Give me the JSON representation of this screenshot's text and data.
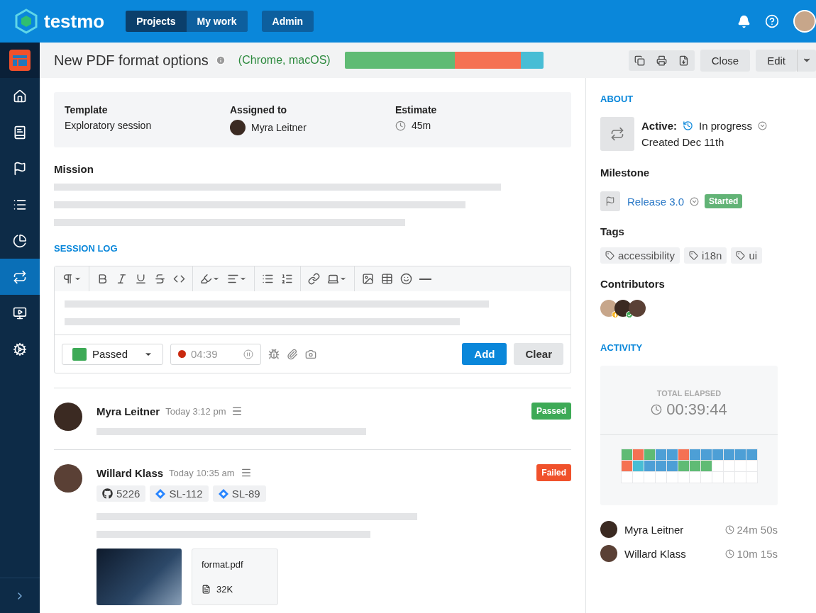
{
  "header": {
    "logo": "testmo",
    "nav": [
      {
        "label": "Projects",
        "selected": true
      },
      {
        "label": "My work",
        "selected": false
      }
    ],
    "admin": "Admin"
  },
  "sidebar": {
    "items": [
      {
        "kind": "home",
        "selected": false
      },
      {
        "kind": "book",
        "selected": false
      },
      {
        "kind": "flag",
        "selected": false
      },
      {
        "kind": "list",
        "selected": false
      },
      {
        "kind": "pie",
        "selected": false
      },
      {
        "kind": "repeat",
        "selected": true
      },
      {
        "kind": "monitor",
        "selected": false
      },
      {
        "kind": "gears",
        "selected": false
      }
    ]
  },
  "titlebar": {
    "title": "New PDF format options",
    "config": "(Chrome, macOS)",
    "close": "Close",
    "edit": "Edit"
  },
  "info": [
    {
      "label": "Template",
      "value": "Exploratory session",
      "kind": "text"
    },
    {
      "label": "Assigned to",
      "value": "Myra Leitner",
      "kind": "user"
    },
    {
      "label": "Estimate",
      "value": "45m",
      "kind": "time"
    }
  ],
  "mission": {
    "label": "Mission"
  },
  "session_log": {
    "label": "SESSION LOG",
    "status": {
      "label": "Passed",
      "color": "#3daa56"
    },
    "timer": "04:39",
    "add": "Add",
    "clear": "Clear"
  },
  "entries": [
    {
      "author": "Myra Leitner",
      "time": "Today 3:12 pm",
      "status": "Passed",
      "color": "#3daa56"
    },
    {
      "author": "Willard Klass",
      "time": "Today 10:35 am",
      "status": "Failed",
      "color": "#f0512b",
      "links": [
        {
          "kind": "github",
          "label": "5226"
        },
        {
          "kind": "jira",
          "label": "SL-112"
        },
        {
          "kind": "jira",
          "label": "SL-89"
        }
      ],
      "attachments": [
        {
          "kind": "image"
        },
        {
          "kind": "file",
          "name": "format.pdf",
          "size": "32K"
        }
      ]
    }
  ],
  "about": {
    "heading": "ABOUT",
    "active_label": "Active:",
    "state": "In progress",
    "created": "Created Dec 11th",
    "milestone_heading": "Milestone",
    "milestone": "Release 3.0",
    "milestone_status": "Started",
    "tags_heading": "Tags",
    "tags": [
      "accessibility",
      "i18n",
      "ui"
    ],
    "contributors_heading": "Contributors",
    "contributors": [
      {
        "kind": "added"
      },
      {
        "kind": "passed"
      },
      {
        "kind": "plain"
      }
    ]
  },
  "activity": {
    "heading": "ACTIVITY",
    "elapsed_label": "TOTAL ELAPSED",
    "elapsed": "00:39:44",
    "cells": [
      {
        "color": "#5fbb74"
      },
      {
        "color": "#f57153"
      },
      {
        "color": "#5fbb74"
      },
      {
        "color": "#4d9fd6"
      },
      {
        "color": "#4d9fd6"
      },
      {
        "color": "#f57153"
      },
      {
        "color": "#4d9fd6"
      },
      {
        "color": "#4d9fd6"
      },
      {
        "color": "#4d9fd6"
      },
      {
        "color": "#4d9fd6"
      },
      {
        "color": "#4d9fd6"
      },
      {
        "color": "#4d9fd6"
      },
      {
        "color": "#f57153"
      },
      {
        "color": "#48bdd5"
      },
      {
        "color": "#4d9fd6"
      },
      {
        "color": "#4d9fd6"
      },
      {
        "color": "#4d9fd6"
      },
      {
        "color": "#5fbb74"
      },
      {
        "color": "#5fbb74"
      },
      {
        "color": "#5fbb74"
      },
      {
        "color": "#ffffff"
      },
      {
        "color": "#ffffff"
      },
      {
        "color": "#ffffff"
      },
      {
        "color": "#ffffff"
      },
      {
        "color": "#ffffff"
      },
      {
        "color": "#ffffff"
      },
      {
        "color": "#ffffff"
      },
      {
        "color": "#ffffff"
      },
      {
        "color": "#ffffff"
      },
      {
        "color": "#ffffff"
      },
      {
        "color": "#ffffff"
      },
      {
        "color": "#ffffff"
      },
      {
        "color": "#ffffff"
      },
      {
        "color": "#ffffff"
      },
      {
        "color": "#ffffff"
      },
      {
        "color": "#ffffff"
      }
    ],
    "people": [
      {
        "name": "Myra Leitner",
        "time": "24m 50s"
      },
      {
        "name": "Willard Klass",
        "time": "10m 15s"
      }
    ]
  }
}
